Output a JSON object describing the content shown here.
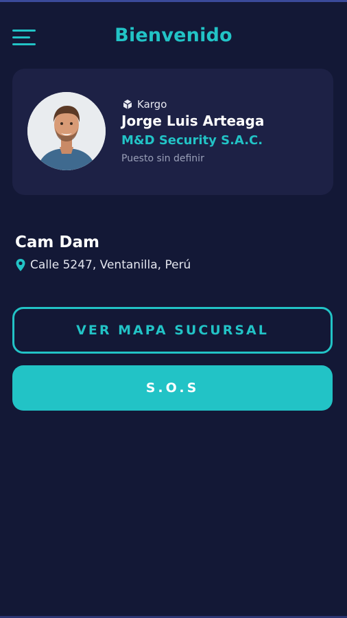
{
  "header": {
    "title": "Bienvenido",
    "menu_icon": "hamburger-menu-icon"
  },
  "profile": {
    "role_icon": "cube-icon",
    "role_label": "Kargo",
    "name": "Jorge Luis Arteaga",
    "company": "M&D Security S.A.C.",
    "position": "Puesto sin definir"
  },
  "branch": {
    "name": "Cam Dam",
    "location_icon": "location-pin-icon",
    "address": "Calle 5247, Ventanilla, Perú"
  },
  "actions": {
    "map_button": "VER MAPA SUCURSAL",
    "sos_button": "S.O.S"
  },
  "colors": {
    "background": "#131836",
    "card": "#1d2145",
    "accent": "#22c3c6",
    "muted_text": "#9aa0b8"
  }
}
